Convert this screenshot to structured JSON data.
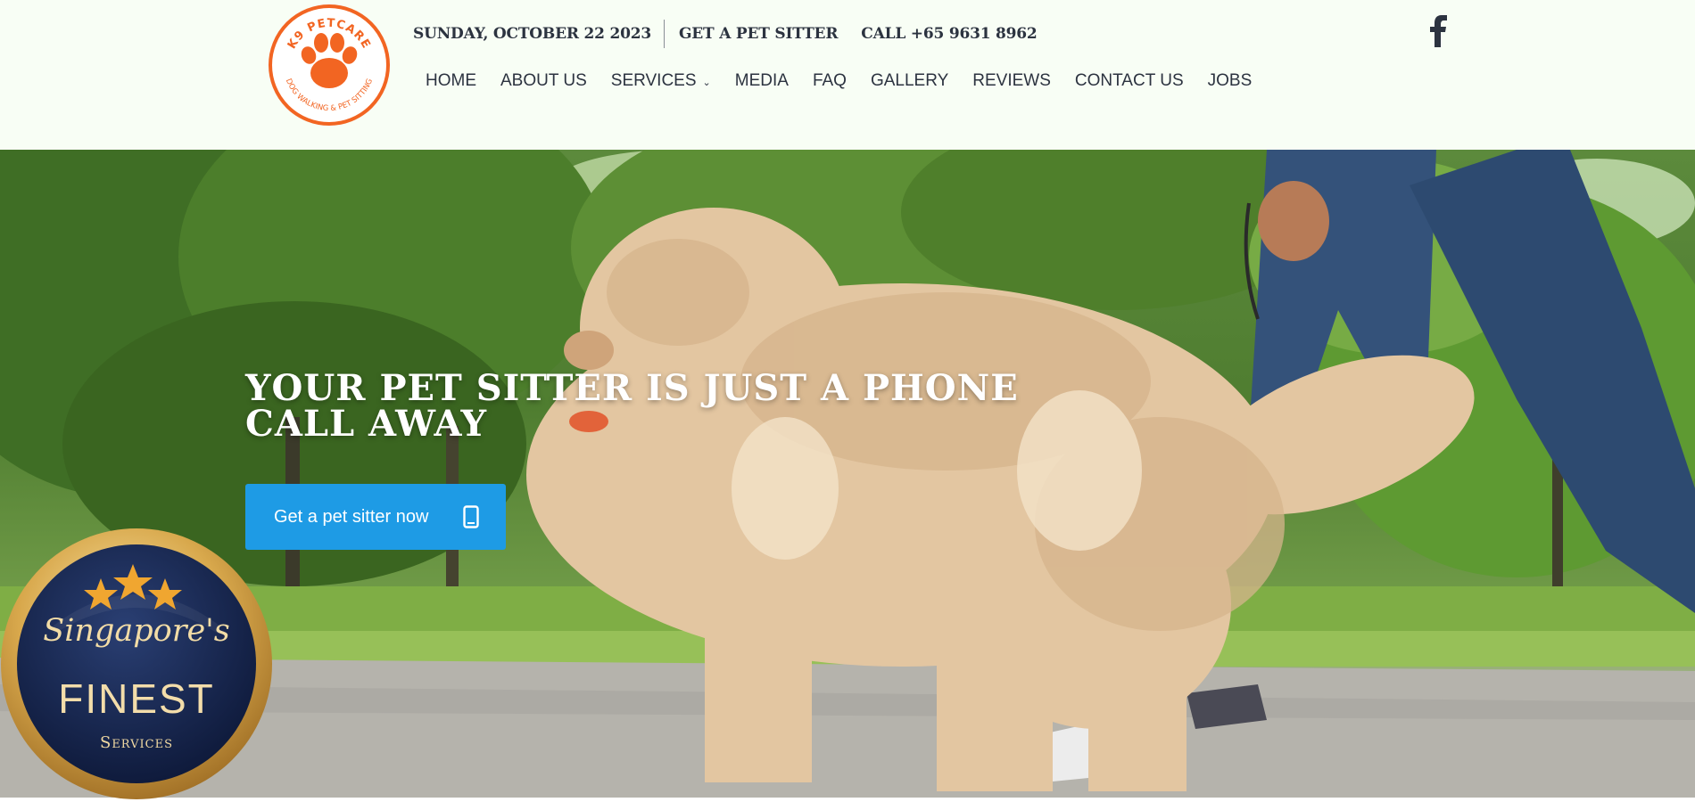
{
  "header": {
    "logo": {
      "top_text": "K9 PETCARE",
      "bottom_text": "DOG WALKING & PET SITTING",
      "brand_color": "#f26522"
    },
    "date": "SUNDAY, OCTOBER 22 2023",
    "get_sitter_link": "GET A PET SITTER",
    "call_text": "CALL +65 9631 8962",
    "facebook_icon": "facebook-icon"
  },
  "nav": {
    "items": [
      "HOME",
      "ABOUT US",
      "SERVICES",
      "MEDIA",
      "FAQ",
      "GALLERY",
      "REVIEWS",
      "CONTACT US",
      "JOBS"
    ]
  },
  "hero": {
    "title_line1": "YOUR PET SITTER IS JUST A PHONE",
    "title_line2": "CALL AWAY",
    "cta_label": "Get a pet sitter now",
    "cta_icon": "mobile-phone-icon",
    "cta_color": "#1e9be5"
  },
  "badge": {
    "stars": 3,
    "script_text": "Singapore's",
    "main_text": "FINEST",
    "sub_text": "Services"
  }
}
